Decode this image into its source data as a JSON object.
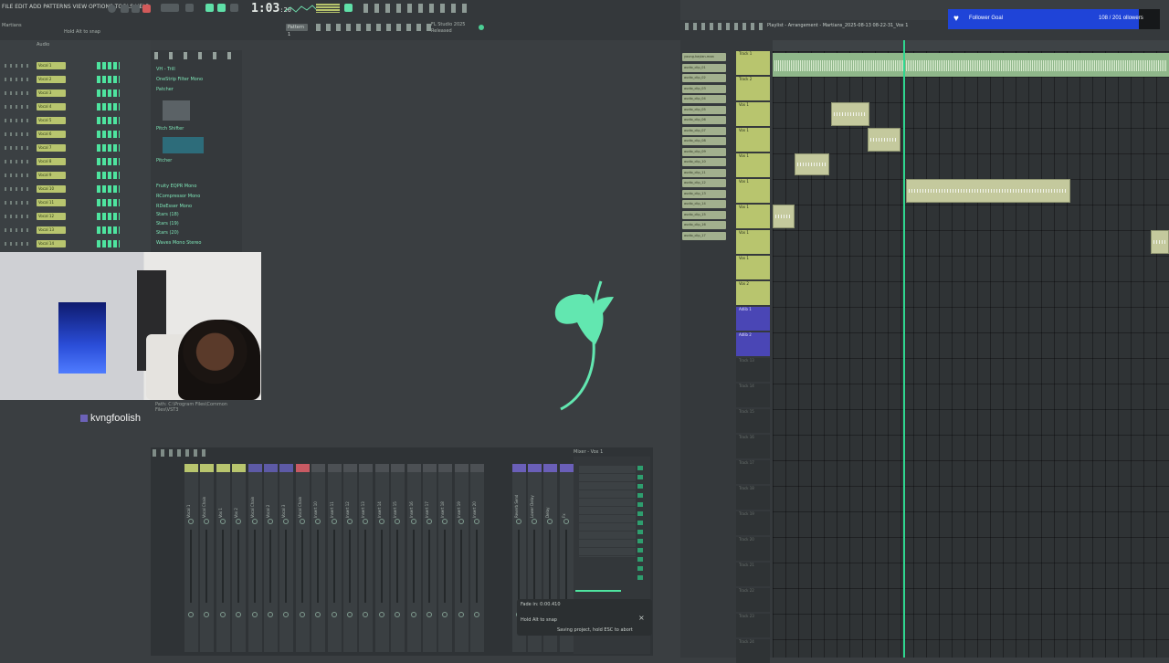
{
  "topbar": {
    "menu": "FILE EDIT ADD PATTERNS VIEW OPTIONS TOOLS HELP",
    "project_name": "Martians",
    "time_hint": "Hold Alt to snap",
    "time": "1:03",
    "time_sub": ":20",
    "pattern": "Pattern 1",
    "version": "FL Studio 2025",
    "version_sub": "Released"
  },
  "channel_rack": {
    "label": "Audio",
    "channels": [
      "Vocal 1",
      "Vocal 2",
      "Vocal 3",
      "Vocal 4",
      "Vocal 5",
      "Vocal 6",
      "Vocal 7",
      "Vocal 8",
      "Vocal 9",
      "Vocal 10",
      "Vocal 11",
      "Vocal 12",
      "Vocal 13",
      "Vocal 14"
    ]
  },
  "browser": {
    "items": [
      "VH - Trill",
      "OneStrip Filter Mono",
      "Patcher",
      "Pitch Shifter",
      "Pitcher",
      "Fruity EQPR Mono",
      "RCompressor Mono",
      "RDeEsser Mono",
      "Stars (18)",
      "Stars (19)",
      "Stars (20)",
      "Waves Mono Stereo"
    ]
  },
  "webcam": {
    "streamer": "kvngfoolish",
    "hint": "Path: C:\\Program Files\\Common Files\\VST3"
  },
  "mixer": {
    "strips": [
      "Vocal 1",
      "Vocal Chain",
      "Vox 1",
      "Vox 2",
      "Vocal Chain",
      "Vocal 2",
      "Vocal 3",
      "Vocal Chain",
      "Insert 10",
      "Insert 11",
      "Insert 12",
      "Insert 13",
      "Insert 14",
      "Insert 15",
      "Insert 16",
      "Insert 17",
      "Insert 18",
      "Insert 19",
      "Insert 20",
      "Reverb Send",
      "Lower Delay",
      "Delay",
      "Fx",
      "Chorus"
    ],
    "fx_title": "Mixer - Vox 1",
    "toast_line1": "Fade in: 0:00.410",
    "toast_line2": "Hold Alt to snap",
    "toast_line3": "Saving project, hold ESC to abort"
  },
  "playlist": {
    "title": "Playlist - Arrangement - Martians_2025-08-13 08-22-31_Vox 1",
    "clip_buttons": [
      "young-kaylan-maa",
      "audio_clip_01",
      "audio_clip_02",
      "audio_clip_03",
      "audio_clip_04",
      "audio_clip_05",
      "audio_clip_06",
      "audio_clip_07",
      "audio_clip_08",
      "audio_clip_09",
      "audio_clip_10",
      "audio_clip_11",
      "audio_clip_12",
      "audio_clip_13",
      "audio_clip_14",
      "audio_clip_15",
      "audio_clip_16",
      "audio_clip_17"
    ],
    "tracks": [
      "Track 1",
      "Track 2",
      "Vox 1",
      "Vox 1",
      "Vox 1",
      "Vox 1",
      "Vox 1",
      "Vox 1",
      "Vox 1",
      "Vox 2",
      "Adlib 1",
      "Adlib 2",
      "Track 13",
      "Track 14",
      "Track 15",
      "Track 16",
      "Track 17",
      "Track 18",
      "Track 19",
      "Track 20",
      "Track 21",
      "Track 22",
      "Track 23",
      "Track 24"
    ]
  },
  "follower_goal": {
    "label": "Follower Goal",
    "count": "108 / 201 ollowers"
  }
}
